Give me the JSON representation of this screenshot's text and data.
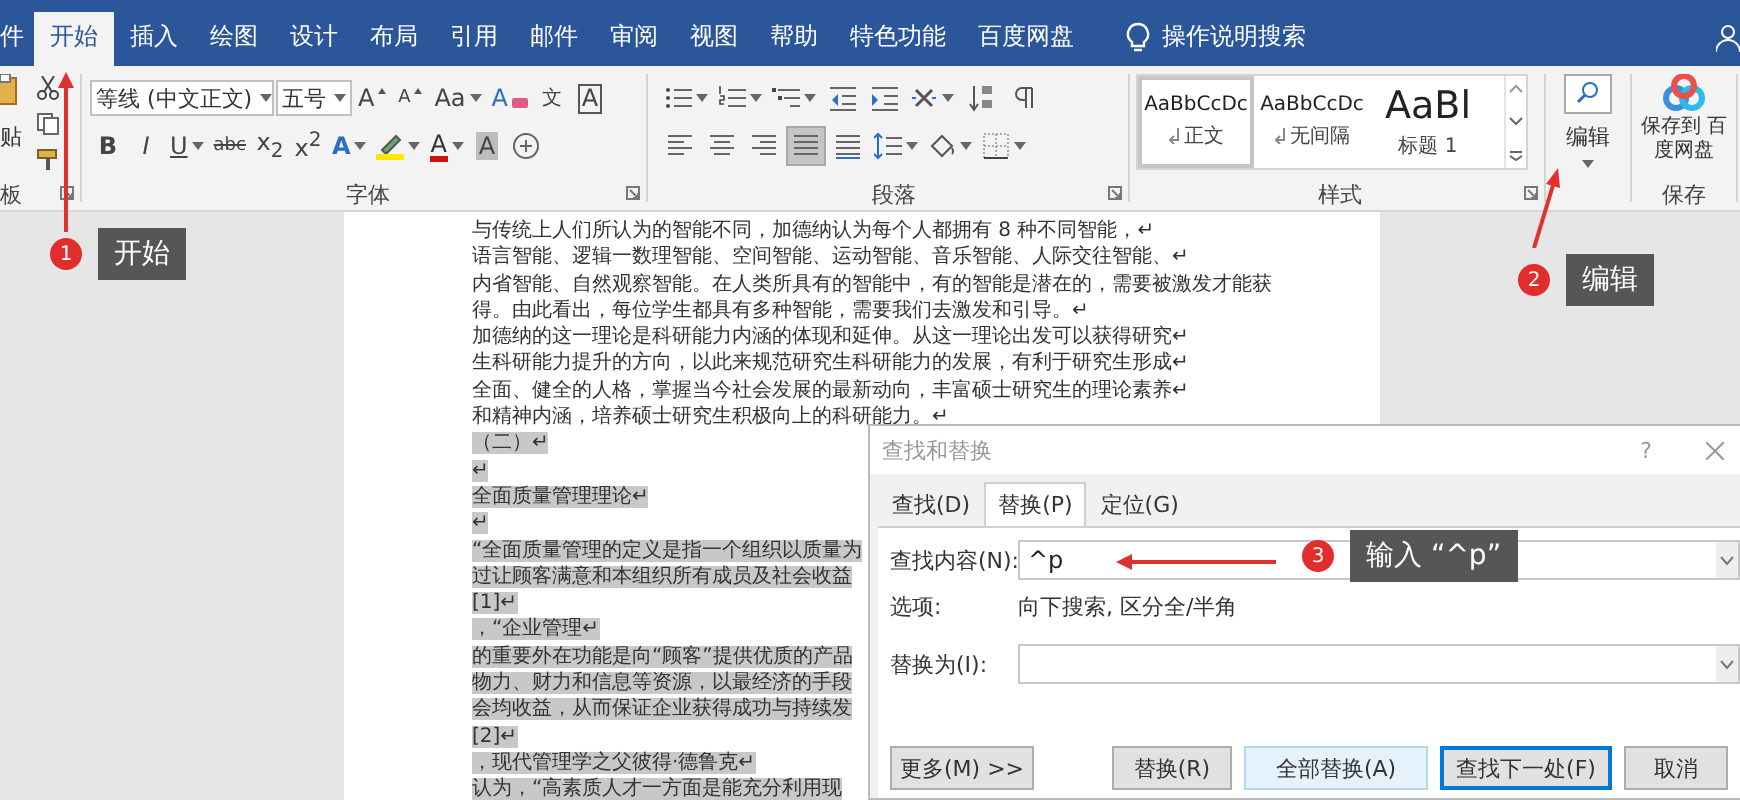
{
  "menu_tabs": [
    {
      "label": "件",
      "selected": false
    },
    {
      "label": "开始",
      "selected": true
    },
    {
      "label": "插入",
      "selected": false
    },
    {
      "label": "绘图",
      "selected": false
    },
    {
      "label": "设计",
      "selected": false
    },
    {
      "label": "布局",
      "selected": false
    },
    {
      "label": "引用",
      "selected": false
    },
    {
      "label": "邮件",
      "selected": false
    },
    {
      "label": "审阅",
      "selected": false
    },
    {
      "label": "视图",
      "selected": false
    },
    {
      "label": "帮助",
      "selected": false
    },
    {
      "label": "特色功能",
      "selected": false
    },
    {
      "label": "百度网盘",
      "selected": false
    }
  ],
  "tell_me": {
    "label": "操作说明搜索"
  },
  "ribbon": {
    "clipboard": {
      "paste_label": "贴",
      "group_label": "板"
    },
    "font": {
      "font_name": "等线 (中文正文)",
      "font_size": "五号",
      "group_label": "字体",
      "row_1": [
        {
          "kind": "grow",
          "label": "A"
        },
        {
          "kind": "shrink",
          "label": "A"
        },
        {
          "kind": "case",
          "label": "Aa"
        },
        {
          "kind": "clear",
          "label": "A"
        },
        {
          "kind": "pinyin",
          "label": "文"
        },
        {
          "kind": "border",
          "label": "A"
        }
      ],
      "row_2": [
        {
          "kind": "bold",
          "label": "B"
        },
        {
          "kind": "italic",
          "label": "I"
        },
        {
          "kind": "underline",
          "label": "U"
        },
        {
          "kind": "strike",
          "label": "abc"
        },
        {
          "kind": "sub",
          "label": "x$_{2}$"
        },
        {
          "kind": "sup",
          "label": "x$^{2}$"
        },
        {
          "kind": "effects",
          "label": "A"
        },
        {
          "kind": "highlight"
        },
        {
          "kind": "color",
          "label": "A"
        },
        {
          "kind": "shading",
          "label": "A"
        },
        {
          "kind": "enclose"
        }
      ]
    },
    "paragraph": {
      "group_label": "段落",
      "row_1": [
        {
          "kind": "bullets"
        },
        {
          "kind": "numbering"
        },
        {
          "kind": "multilevel"
        },
        {
          "kind": "outdent"
        },
        {
          "kind": "indent"
        },
        {
          "kind": "asian"
        },
        {
          "kind": "sort"
        },
        {
          "kind": "marks"
        }
      ],
      "alignment": [
        {
          "kind": "left",
          "selected": false
        },
        {
          "kind": "center",
          "selected": false
        },
        {
          "kind": "right",
          "selected": false
        },
        {
          "kind": "justify",
          "selected": true
        },
        {
          "kind": "distribute",
          "selected": false
        }
      ],
      "row_2": [
        {
          "kind": "spacing"
        },
        {
          "kind": "shading"
        },
        {
          "kind": "borders"
        }
      ]
    },
    "styles": {
      "group_label": "样式",
      "items": [
        {
          "preview": "AaBbCcDc",
          "name": "正文",
          "kind": "body",
          "selected": true
        },
        {
          "preview": "AaBbCcDc",
          "name": "无间隔",
          "kind": "body",
          "selected": false
        },
        {
          "preview": "AaBl",
          "name": "标题 1",
          "kind": "heading",
          "selected": false
        }
      ]
    },
    "editing": {
      "label": "编辑"
    },
    "save": {
      "label": "保存到 百度网盘",
      "group_label": "保存"
    }
  },
  "document": {
    "lines": [
      {
        "text": "与传统上人们所认为的智能不同，加德纳认为每个人都拥有 8 种不同智能，↵",
        "selected": false
      },
      {
        "text": "语言智能、逻辑一数理智能、空间智能、运动智能、音乐智能、人际交往智能、↵",
        "selected": false
      },
      {
        "text": "内省智能、自然观察智能。在人类所具有的智能中，有的智能是潜在的，需要被激发才能获",
        "selected": false
      },
      {
        "text": "得。由此看出，每位学生都具有多种智能，需要我们去激发和引导。↵",
        "selected": false
      },
      {
        "text": "加德纳的这一理论是科研能力内涵的体现和延伸。从这一理论出发可以获得研究↵",
        "selected": false
      },
      {
        "text": "生科研能力提升的方向，以此来规范研究生科研能力的发展，有利于研究生形成↵",
        "selected": false
      },
      {
        "text": "全面、健全的人格，掌握当今社会发展的最新动向，丰富硕士研究生的理论素养↵",
        "selected": false
      },
      {
        "text": "和精神内涵，培养硕士研究生积极向上的科研能力。↵",
        "selected": false
      },
      {
        "text": "（二）↵",
        "selected": true
      },
      {
        "text": "↵",
        "selected": true
      },
      {
        "text": "全面质量管理理论↵",
        "selected": true
      },
      {
        "text": "↵",
        "selected": true
      },
      {
        "text": "“全面质量管理的定义是指一个组织以质量为",
        "selected": true
      },
      {
        "text": "过让顾客满意和本组织所有成员及社会收益",
        "selected": true
      },
      {
        "text": "[1]↵",
        "selected": true
      },
      {
        "text": "，“企业管理↵",
        "selected": true
      },
      {
        "text": "的重要外在功能是向“顾客”提供优质的产品",
        "selected": true
      },
      {
        "text": "物力、财力和信息等资源，以最经济的手段",
        "selected": true
      },
      {
        "text": "会均收益，从而保证企业获得成功与持续发",
        "selected": true
      },
      {
        "text": "[2]↵",
        "selected": true
      },
      {
        "text": "，现代管理学之父彼得·德鲁克↵",
        "selected": true
      },
      {
        "text": "认为，“高素质人才一方面是能充分利用现",
        "selected": true
      }
    ]
  },
  "dialog": {
    "title": "查找和替换",
    "help": "?",
    "tabs": [
      {
        "label": "查找(D)",
        "selected": false
      },
      {
        "label": "替换(P)",
        "selected": true
      },
      {
        "label": "定位(G)",
        "selected": false
      }
    ],
    "find": {
      "label": "查找内容(N):",
      "value": "^p"
    },
    "options": {
      "label": "选项:",
      "value": "向下搜索, 区分全/半角"
    },
    "replace": {
      "label": "替换为(I):"
    },
    "buttons": [
      {
        "label": "更多(M) >>",
        "kind": "normal"
      },
      {
        "label": "替换(R)",
        "kind": "normal"
      },
      {
        "label": "全部替换(A)",
        "kind": "hot"
      },
      {
        "label": "查找下一处(F)",
        "kind": "default"
      },
      {
        "label": "取消",
        "kind": "normal"
      }
    ]
  },
  "callouts": [
    {
      "number": "1",
      "label": "开始"
    },
    {
      "number": "2",
      "label": "编辑"
    },
    {
      "number": "3",
      "label": "输入 “^p”"
    }
  ]
}
